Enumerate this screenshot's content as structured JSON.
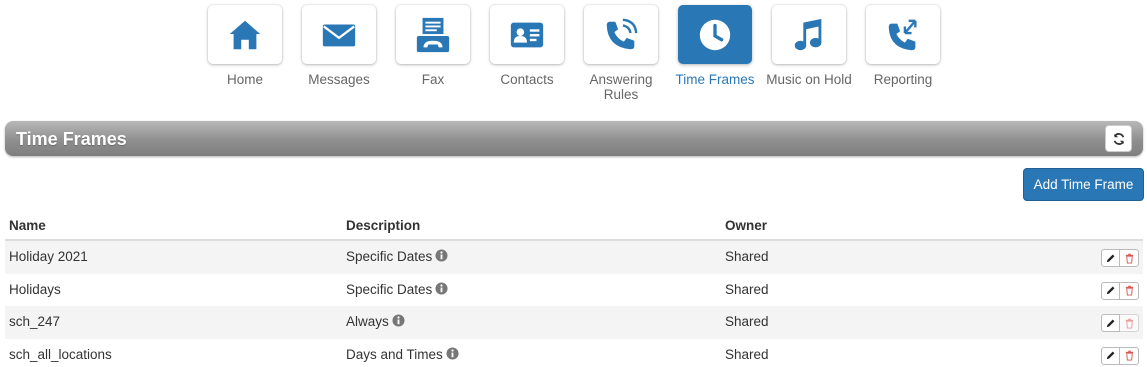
{
  "nav": {
    "items": [
      {
        "label": "Home",
        "icon": "home-icon"
      },
      {
        "label": "Messages",
        "icon": "envelope-icon"
      },
      {
        "label": "Fax",
        "icon": "fax-icon"
      },
      {
        "label": "Contacts",
        "icon": "contact-card-icon"
      },
      {
        "label": "Answering Rules",
        "icon": "phone-rules-icon"
      },
      {
        "label": "Time Frames",
        "icon": "clock-icon",
        "active": true
      },
      {
        "label": "Music on Hold",
        "icon": "music-note-icon"
      },
      {
        "label": "Reporting",
        "icon": "call-report-icon"
      }
    ]
  },
  "section": {
    "title": "Time Frames",
    "refresh_icon": "refresh-icon"
  },
  "add_button": "Add Time Frame",
  "table": {
    "columns": [
      "Name",
      "Description",
      "Owner"
    ],
    "rows": [
      {
        "name": "Holiday 2021",
        "description": "Specific Dates",
        "owner": "Shared",
        "delete_enabled": true
      },
      {
        "name": "Holidays",
        "description": "Specific Dates",
        "owner": "Shared",
        "delete_enabled": true
      },
      {
        "name": "sch_247",
        "description": "Always",
        "owner": "Shared",
        "delete_enabled": false
      },
      {
        "name": "sch_all_locations",
        "description": "Days and Times",
        "owner": "Shared",
        "delete_enabled": true
      }
    ]
  },
  "colors": {
    "accent": "#2a77b5",
    "delete": "#d9534f"
  }
}
